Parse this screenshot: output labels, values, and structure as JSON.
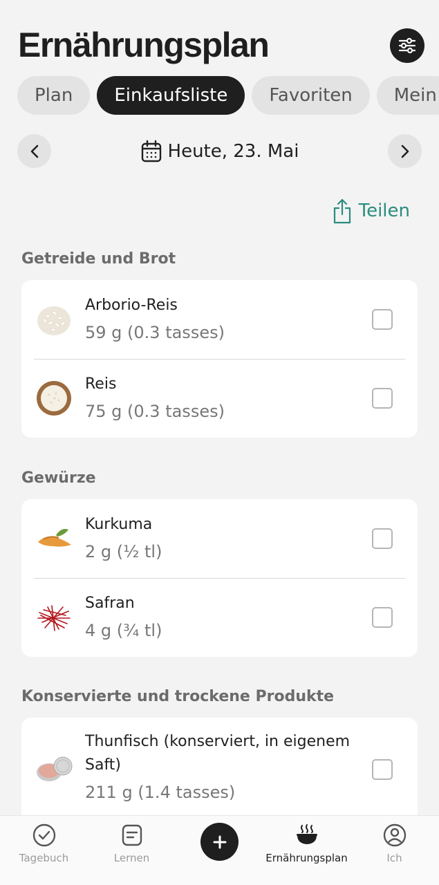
{
  "header": {
    "title": "Ernährungsplan"
  },
  "tabs": [
    {
      "label": "Plan",
      "active": false
    },
    {
      "label": "Einkaufsliste",
      "active": true
    },
    {
      "label": "Favoriten",
      "active": false
    },
    {
      "label": "Mein",
      "active": false
    }
  ],
  "date": {
    "label": "Heute, 23. Mai"
  },
  "share": {
    "label": "Teilen"
  },
  "sections": [
    {
      "title": "Getreide und Brot",
      "items": [
        {
          "name": "Arborio-Reis",
          "qty": "59 g (0.3 tasses)",
          "checked": false
        },
        {
          "name": "Reis",
          "qty": "75 g (0.3 tasses)",
          "checked": false
        }
      ]
    },
    {
      "title": "Gewürze",
      "items": [
        {
          "name": "Kurkuma",
          "qty": "2 g (½ tl)",
          "checked": false
        },
        {
          "name": "Safran",
          "qty": "4 g (¾ tl)",
          "checked": false
        }
      ]
    },
    {
      "title": "Konservierte und trockene Produkte",
      "items": [
        {
          "name": "Thunfisch (konserviert, in eigenem Saft)",
          "qty": "211 g (1.4 tasses)",
          "checked": false
        }
      ]
    }
  ],
  "bottom_nav": {
    "tagebuch": "Tagebuch",
    "lernen": "Lernen",
    "plan": "Ernährungsplan",
    "ich": "Ich"
  },
  "colors": {
    "accent": "#2a8c7e",
    "dark": "#1f1f1f",
    "background": "#f3f3f3"
  }
}
